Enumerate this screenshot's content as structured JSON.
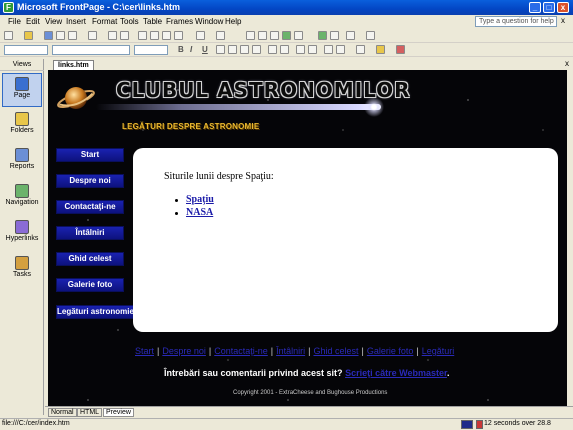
{
  "window": {
    "title": "Microsoft FrontPage - C:\\cer\\links.htm",
    "app_icon": "frontpage-icon",
    "min_label": "_",
    "max_label": "□",
    "close_label": "x"
  },
  "menu": [
    "File",
    "Edit",
    "View",
    "Insert",
    "Format",
    "Tools",
    "Table",
    "Frames",
    "Window",
    "Help"
  ],
  "help_box": {
    "placeholder": "Type a question for help",
    "close": "x"
  },
  "views": {
    "header": "Views",
    "items": [
      {
        "label": "Page",
        "icon": "page-view-icon",
        "color": "#3a6fd0"
      },
      {
        "label": "Folders",
        "icon": "folder-icon",
        "color": "#e8c64a"
      },
      {
        "label": "Reports",
        "icon": "reports-icon",
        "color": "#6b8fd6"
      },
      {
        "label": "Navigation",
        "icon": "navigation-icon",
        "color": "#6bb36b"
      },
      {
        "label": "Hyperlinks",
        "icon": "hyperlinks-icon",
        "color": "#8a6bd6"
      },
      {
        "label": "Tasks",
        "icon": "tasks-icon",
        "color": "#d4a040"
      }
    ]
  },
  "doc_tab": {
    "label": "links.htm",
    "close": "x"
  },
  "page": {
    "logo_text": "CLUBUL ASTRONOMILOR",
    "subtitle": "LEGĂTURI DESPRE ASTRONOMIE",
    "nav": [
      "Start",
      "Despre noi",
      "Contactaţi-ne",
      "Întâlniri",
      "Ghid celest",
      "Galerie foto",
      "Legături astronomie"
    ],
    "content_heading": "Siturile lunii despre Spaţiu:",
    "content_links": [
      "Spaţiu",
      "NASA"
    ],
    "footer_links": [
      "Start",
      "Despre noi",
      "Contactaţi-ne",
      "Întâlniri",
      "Ghid celest",
      "Galerie foto",
      "Legături"
    ],
    "footer_sep": "|",
    "question_text": "Întrebări sau comentarii privind acest sit?",
    "question_link": "Scrieţi către Webmaster",
    "question_end": ".",
    "copyright": "Copyright 2001 - ExtraCheese and Bughouse Productions"
  },
  "mode_tabs": [
    "Normal",
    "HTML",
    "Preview"
  ],
  "mode_active": "Preview",
  "status": {
    "path": "file:///C:/cer/index.htm",
    "speed": "12 seconds over 28.8"
  },
  "colors": {
    "accent": "#0a5fdc",
    "subtitle": "#e9b82f",
    "nav_button": "#1a22b0",
    "link": "#2a2ab8"
  }
}
